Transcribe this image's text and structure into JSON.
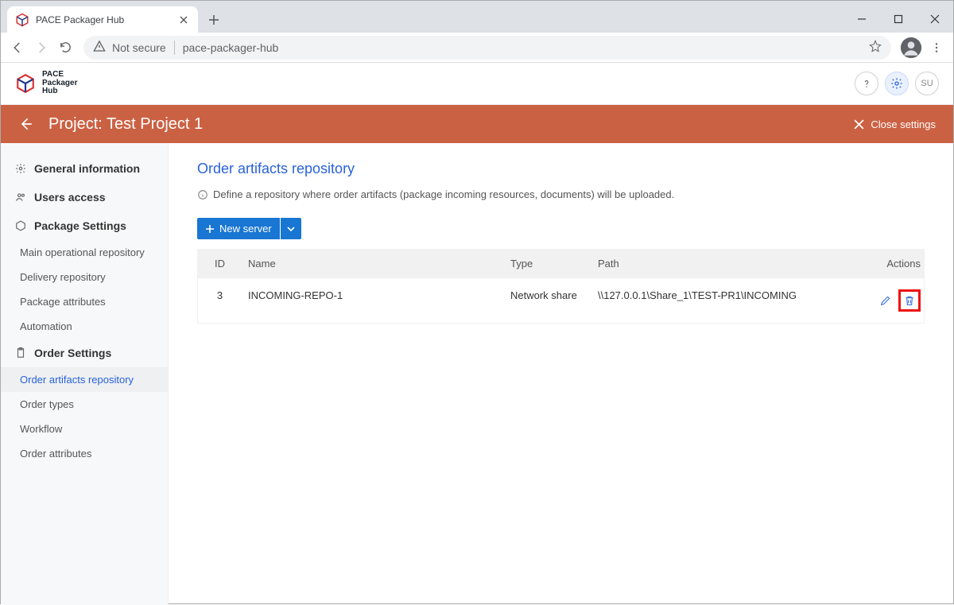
{
  "browser": {
    "tab_title": "PACE Packager Hub",
    "security_text": "Not secure",
    "url": "pace-packager-hub"
  },
  "app": {
    "logo_line1": "PACE",
    "logo_line2": "Packager",
    "logo_line3": "Hub",
    "user_initials": "SU"
  },
  "projbar": {
    "title": "Project: Test Project 1",
    "close_label": "Close settings"
  },
  "sidebar": {
    "cat_general": "General information",
    "cat_users": "Users access",
    "cat_package": "Package Settings",
    "pkg_items": {
      "main_repo": "Main operational repository",
      "delivery_repo": "Delivery repository",
      "pkg_attrs": "Package attributes",
      "automation": "Automation"
    },
    "cat_order": "Order Settings",
    "ord_items": {
      "artifacts": "Order artifacts repository",
      "types": "Order types",
      "workflow": "Workflow",
      "attrs": "Order attributes"
    }
  },
  "content": {
    "heading": "Order artifacts repository",
    "hint": "Define a repository where order artifacts (package incoming resources, documents) will be uploaded.",
    "new_server_label": "New server",
    "columns": {
      "id": "ID",
      "name": "Name",
      "type": "Type",
      "path": "Path",
      "actions": "Actions"
    },
    "rows": {
      "0": {
        "id": "3",
        "name": "INCOMING-REPO-1",
        "type": "Network share",
        "path": "\\\\127.0.0.1\\Share_1\\TEST-PR1\\INCOMING"
      }
    }
  }
}
